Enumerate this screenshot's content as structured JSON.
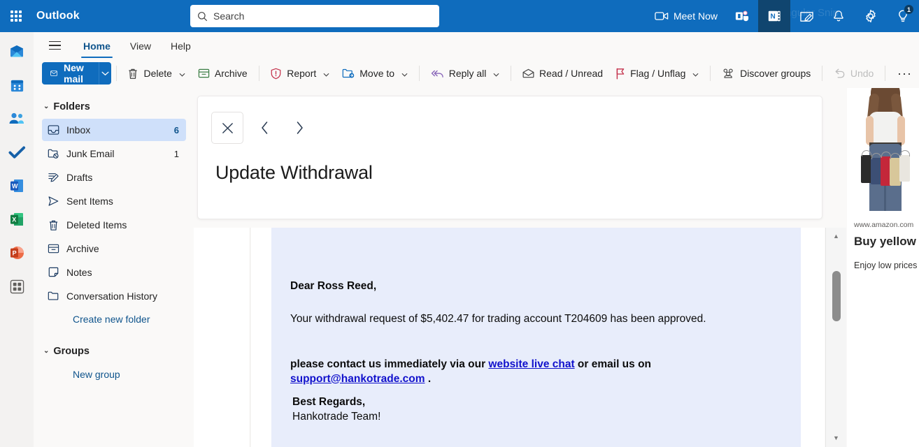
{
  "suite": {
    "brand": "Outlook",
    "waffle_label": "app-launcher",
    "search_placeholder": "Search",
    "search_value": "",
    "meet_now": "Meet Now",
    "ghost_tooltip": "Rectangular Snip",
    "icons": [
      {
        "name": "teams-icon",
        "label": "Teams"
      },
      {
        "name": "onenote-icon",
        "label": "OneNote",
        "active": true
      },
      {
        "name": "todo-notes-icon",
        "label": "Notes"
      },
      {
        "name": "bell-icon",
        "label": "Notifications"
      },
      {
        "name": "gear-icon",
        "label": "Settings"
      },
      {
        "name": "lightbulb-icon",
        "label": "Tips",
        "badge": "1"
      }
    ]
  },
  "app_rail": [
    {
      "name": "mail-app-icon",
      "label": "Mail",
      "selected": true
    },
    {
      "name": "calendar-app-icon",
      "label": "Calendar",
      "selected": false
    },
    {
      "name": "people-app-icon",
      "label": "People",
      "selected": false
    },
    {
      "name": "todo-app-icon",
      "label": "To Do",
      "selected": false
    },
    {
      "name": "word-app-icon",
      "label": "Word",
      "selected": false
    },
    {
      "name": "excel-app-icon",
      "label": "Excel",
      "selected": false
    },
    {
      "name": "powerpoint-app-icon",
      "label": "PowerPoint",
      "selected": false
    },
    {
      "name": "all-apps-icon",
      "label": "All apps",
      "selected": false
    }
  ],
  "ribbon": {
    "tabs": [
      {
        "label": "Home",
        "selected": true
      },
      {
        "label": "View",
        "selected": false
      },
      {
        "label": "Help",
        "selected": false
      }
    ],
    "new_mail": "New mail",
    "commands": [
      {
        "label": "Delete",
        "icon": "trash-icon",
        "caret": true,
        "disabled": false
      },
      {
        "label": "Archive",
        "icon": "archive-icon",
        "caret": false,
        "disabled": false
      },
      {
        "label": "Report",
        "icon": "report-shield-icon",
        "caret": true,
        "disabled": false
      },
      {
        "label": "Move to",
        "icon": "move-folder-icon",
        "caret": true,
        "disabled": false
      },
      {
        "label": "Reply all",
        "icon": "reply-all-icon",
        "caret": true,
        "disabled": false
      },
      {
        "label": "Read / Unread",
        "icon": "envelope-icon",
        "caret": false,
        "disabled": false
      },
      {
        "label": "Flag / Unflag",
        "icon": "flag-icon",
        "caret": true,
        "disabled": false
      },
      {
        "label": "Discover groups",
        "icon": "people-group-icon",
        "caret": false,
        "disabled": false
      },
      {
        "label": "Undo",
        "icon": "undo-icon",
        "caret": false,
        "disabled": true
      }
    ],
    "overflow": "···"
  },
  "folder_pane": {
    "folders_header": "Folders",
    "folders": [
      {
        "label": "Inbox",
        "count": "6",
        "icon": "inbox-icon",
        "selected": true
      },
      {
        "label": "Junk Email",
        "count": "1",
        "icon": "junk-icon",
        "selected": false
      },
      {
        "label": "Drafts",
        "count": "",
        "icon": "drafts-pencil-icon",
        "selected": false
      },
      {
        "label": "Sent Items",
        "count": "",
        "icon": "send-icon",
        "selected": false
      },
      {
        "label": "Deleted Items",
        "count": "",
        "icon": "trash-icon",
        "selected": false
      },
      {
        "label": "Archive",
        "count": "",
        "icon": "archive-icon",
        "selected": false
      },
      {
        "label": "Notes",
        "count": "",
        "icon": "note-icon",
        "selected": false
      },
      {
        "label": "Conversation History",
        "count": "",
        "icon": "folder-icon",
        "selected": false
      }
    ],
    "create_new_folder": "Create new folder",
    "groups_header": "Groups",
    "new_group": "New group"
  },
  "overlay": {
    "close_label": "Close",
    "prev_label": "Previous item",
    "next_label": "Next item",
    "title": "Update Withdrawal"
  },
  "email_body": {
    "salutation": "Dear Ross Reed,",
    "line_request": "Your withdrawal request of $5,402.47 for trading account T204609 has been approved.",
    "contact_pre": "please contact us immediately via our ",
    "contact_link": "website live chat",
    "contact_mid": " or email us on",
    "contact_email": "support@hankotrade.com",
    "contact_post": " .",
    "signoff": "Best Regards,",
    "team": "Hankotrade Team!",
    "background_color": "#e8edfb",
    "link_color": "#1111cc"
  },
  "ad_pane": {
    "image_alt": "woman-holding-shopping-bags",
    "url": "www.amazon.com",
    "title": "Buy yellow sequin skirt for women - Amazon.com Official Site",
    "description": "Enjoy low prices and get fast, free delivery with Prime on millions of products. Discover new arrivals & latest discounts in yellow sequin skirt for women from your favorite brands."
  },
  "scrollbar": {
    "up_arrow": "▲",
    "down_arrow": "▼"
  },
  "colors": {
    "suite_blue": "#0f6cbd",
    "accent": "#0f6cbd",
    "selected_folder": "#cfe0fa",
    "email_bg": "#e8edfb"
  }
}
